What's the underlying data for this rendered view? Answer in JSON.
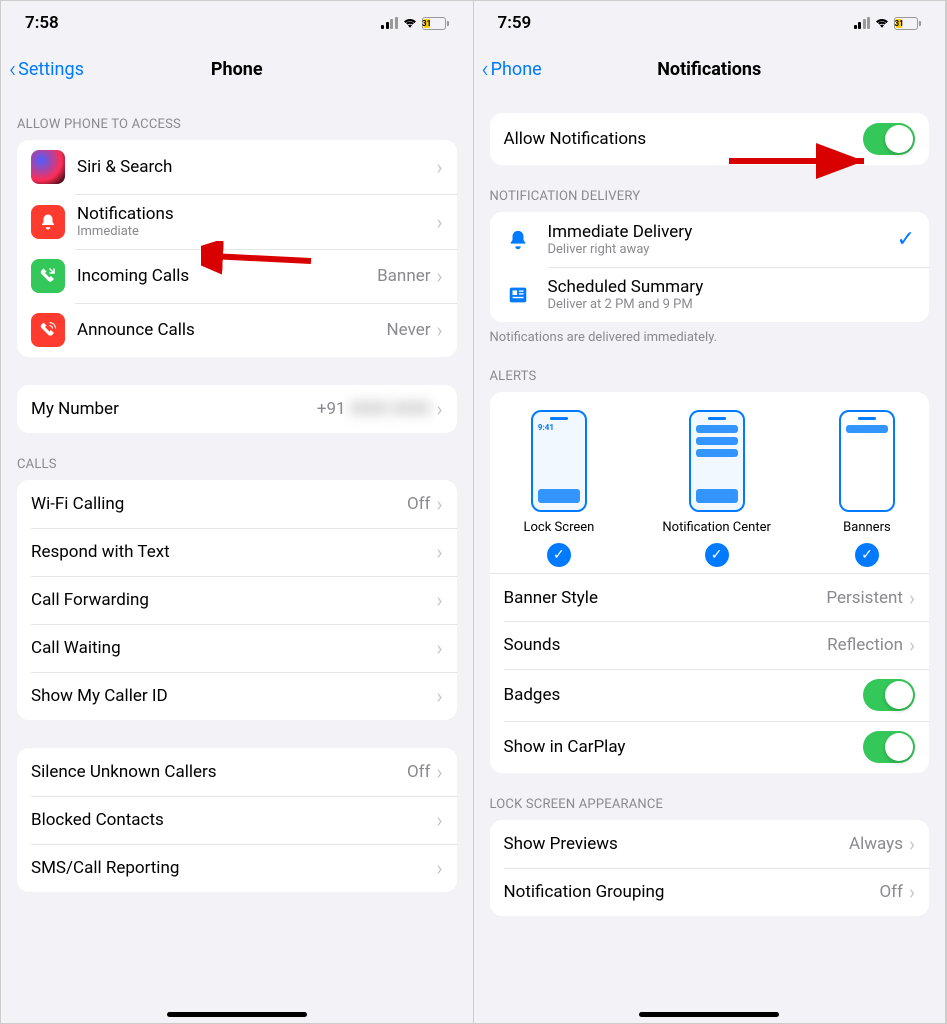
{
  "left": {
    "status": {
      "time": "7:58",
      "battery": "31"
    },
    "nav": {
      "back": "Settings",
      "title": "Phone"
    },
    "sectionAccess": "Allow Phone to Access",
    "rows": {
      "siri": "Siri & Search",
      "notifications": "Notifications",
      "notificationsSub": "Immediate",
      "incoming": "Incoming Calls",
      "incomingDetail": "Banner",
      "announce": "Announce Calls",
      "announceDetail": "Never",
      "myNumber": "My Number",
      "myNumberDetail": "+91"
    },
    "sectionCalls": "Calls",
    "calls": {
      "wifi": "Wi-Fi Calling",
      "wifiDetail": "Off",
      "respond": "Respond with Text",
      "forwarding": "Call Forwarding",
      "waiting": "Call Waiting",
      "callerid": "Show My Caller ID",
      "silence": "Silence Unknown Callers",
      "silenceDetail": "Off",
      "blocked": "Blocked Contacts",
      "sms": "SMS/Call Reporting"
    }
  },
  "right": {
    "status": {
      "time": "7:59",
      "battery": "31"
    },
    "nav": {
      "back": "Phone",
      "title": "Notifications"
    },
    "allow": "Allow Notifications",
    "sectionDelivery": "Notification Delivery",
    "delivery": {
      "immediate": "Immediate Delivery",
      "immediateSub": "Deliver right away",
      "scheduled": "Scheduled Summary",
      "scheduledSub": "Deliver at 2 PM and 9 PM"
    },
    "deliveryFooter": "Notifications are delivered immediately.",
    "sectionAlerts": "Alerts",
    "alerts": {
      "previewTime": "9:41",
      "lock": "Lock Screen",
      "center": "Notification Center",
      "banners": "Banners",
      "bannerStyle": "Banner Style",
      "bannerStyleDetail": "Persistent",
      "sounds": "Sounds",
      "soundsDetail": "Reflection",
      "badges": "Badges",
      "carplay": "Show in CarPlay"
    },
    "sectionLock": "Lock Screen Appearance",
    "lock": {
      "previews": "Show Previews",
      "previewsDetail": "Always",
      "grouping": "Notification Grouping",
      "groupingDetail": "Off"
    }
  }
}
